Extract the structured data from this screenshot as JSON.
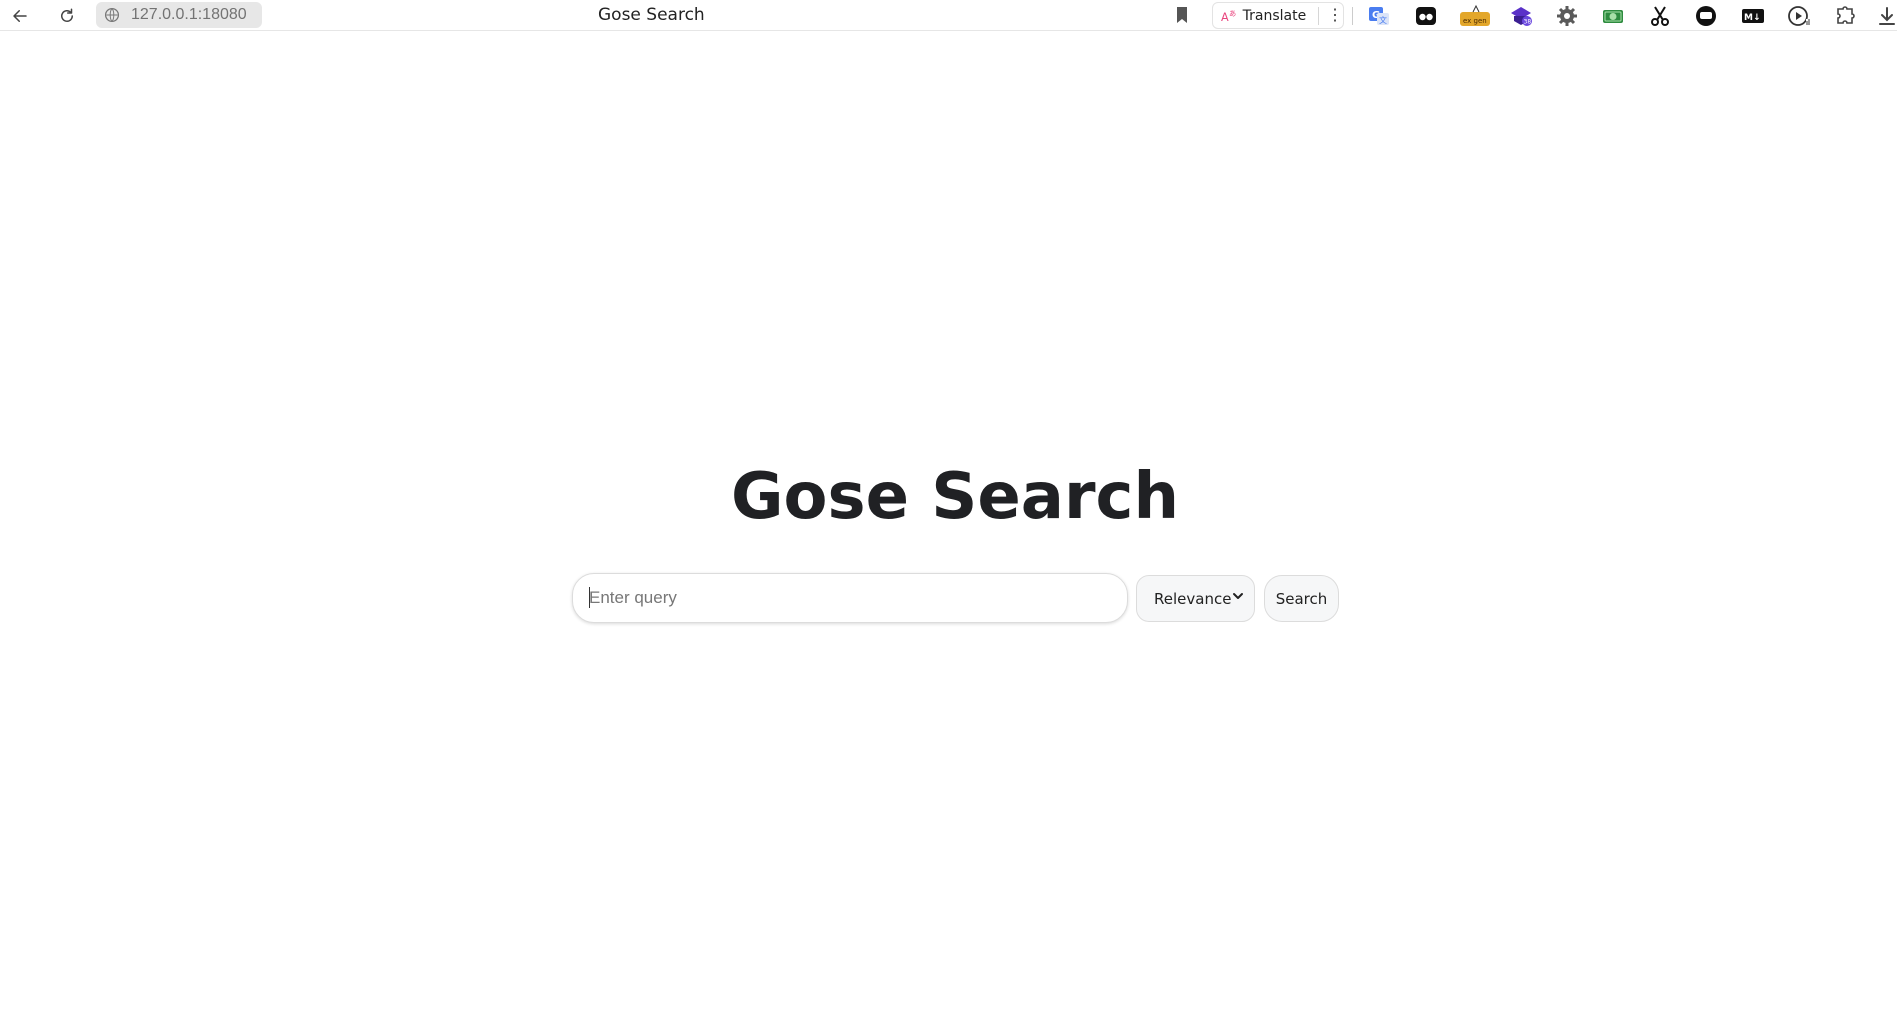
{
  "browser": {
    "url": "127.0.0.1:18080",
    "tab_title": "Gose Search",
    "translate_label": "Translate",
    "extensions": [
      {
        "name": "google-translate-icon"
      },
      {
        "name": "dark-reader-icon"
      },
      {
        "name": "ex-gen-icon",
        "label": "ex gen"
      },
      {
        "name": "stack-badge-icon",
        "badge": "38"
      },
      {
        "name": "settings-gear-icon"
      },
      {
        "name": "money-icon"
      },
      {
        "name": "scissors-icon"
      },
      {
        "name": "chat-bubble-icon"
      },
      {
        "name": "markdown-icon",
        "label": "M↓"
      },
      {
        "name": "video-play-icon"
      },
      {
        "name": "puzzle-icon"
      },
      {
        "name": "download-icon"
      }
    ]
  },
  "main": {
    "title": "Gose Search",
    "search_placeholder": "Enter query",
    "search_value": "",
    "sort_selected": "Relevance",
    "search_button_label": "Search"
  },
  "colors": {
    "title": "#202124",
    "translate_accent": "#e9457e",
    "translate_ext_blue": "#4a7df0",
    "ex_gen_yellow": "#e3a72b",
    "stack_purple": "#5a31c8",
    "money_green": "#2e8b3f"
  }
}
